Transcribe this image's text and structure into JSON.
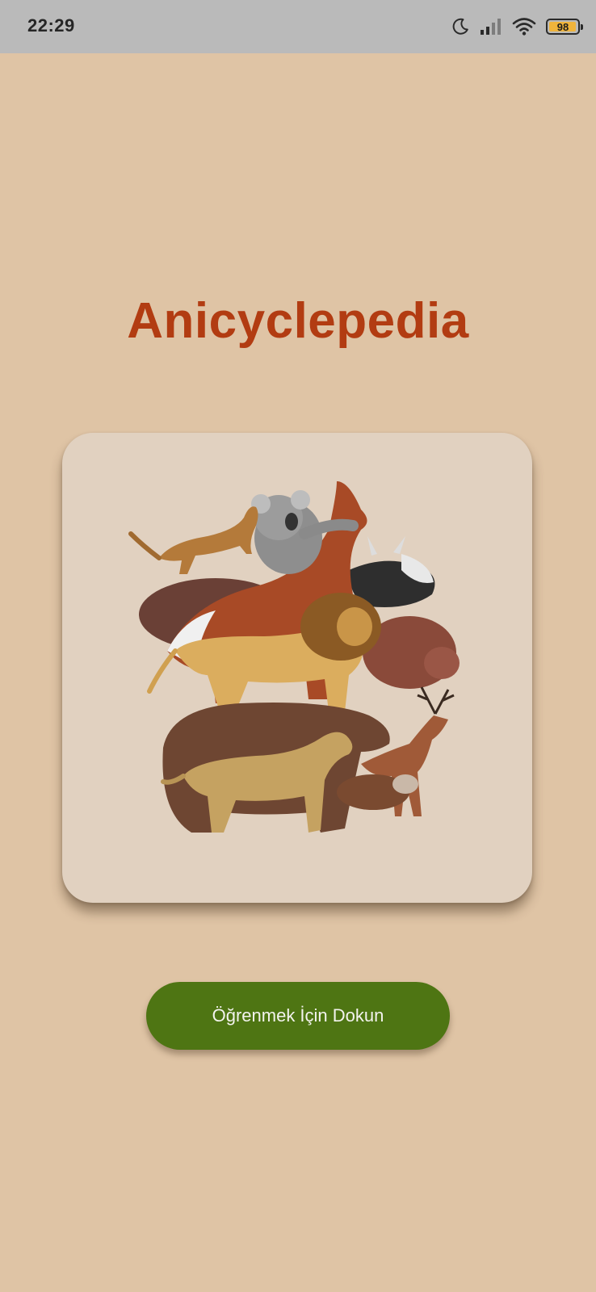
{
  "status_bar": {
    "time": "22:29",
    "battery_level": "98",
    "battery_fraction": 0.98,
    "icons": [
      "moon-icon",
      "cellular-signal-icon",
      "wifi-icon",
      "battery-icon"
    ]
  },
  "app": {
    "title": "Anicyclepedia"
  },
  "hero": {
    "image": "animals-collage-image",
    "animals": [
      "cat",
      "koala",
      "horse",
      "bull",
      "hippo",
      "lion",
      "bear",
      "dog",
      "deer",
      "ferret"
    ]
  },
  "cta": {
    "label": "Öğrenmek İçin Dokun"
  },
  "colors": {
    "background": "#dfc4a5",
    "status_bar": "#bababa",
    "title": "#b23c12",
    "card": "#e1d1c0",
    "button": "#4e7513",
    "button_text": "#f3f3ee"
  }
}
